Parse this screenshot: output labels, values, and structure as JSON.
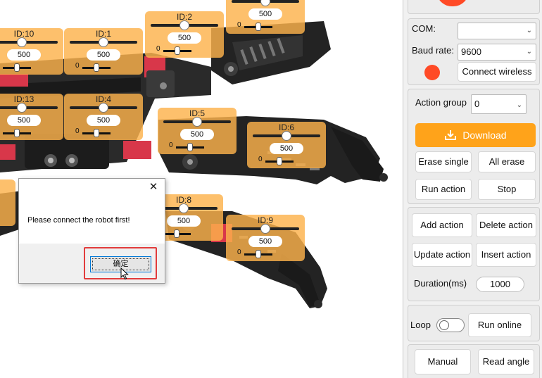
{
  "servos": [
    {
      "id": "ID:10",
      "value": "500",
      "zero": "0"
    },
    {
      "id": "ID:1",
      "value": "500",
      "zero": "0"
    },
    {
      "id": "ID:2",
      "value": "500",
      "zero": "0"
    },
    {
      "id": "",
      "value": "500",
      "zero": "0"
    },
    {
      "id": "ID:13",
      "value": "500",
      "zero": "0"
    },
    {
      "id": "ID:4",
      "value": "500",
      "zero": "0"
    },
    {
      "id": "ID:5",
      "value": "500",
      "zero": "0"
    },
    {
      "id": "ID:6",
      "value": "500",
      "zero": "0"
    },
    {
      "id": "ID:8",
      "value": "500",
      "zero": "0"
    },
    {
      "id": "ID:9",
      "value": "500",
      "zero": "0"
    }
  ],
  "dialog": {
    "message": "Please connect the robot first!",
    "ok_label": "确定",
    "close_glyph": "✕"
  },
  "connection": {
    "com_label": "COM:",
    "com_value": "",
    "baud_label": "Baud rate:",
    "baud_value": "9600",
    "connect_label": "Connect wireless",
    "status_color": "#ff4a26"
  },
  "action": {
    "group_label": "Action group",
    "group_value": "0",
    "download_label": "Download",
    "erase_single": "Erase single",
    "all_erase": "All erase",
    "run_action": "Run action",
    "stop": "Stop"
  },
  "editing": {
    "add_action": "Add action",
    "delete_action": "Delete action",
    "update_action": "Update action",
    "insert_action": "Insert action",
    "duration_label": "Duration(ms)",
    "duration_value": "1000"
  },
  "online": {
    "loop_label": "Loop",
    "loop_on": false,
    "run_online": "Run online"
  },
  "bottom": {
    "manual": "Manual",
    "read_angle": "Read angle"
  },
  "colors": {
    "accent": "#ffa31a",
    "servo_panel": "#fdb24c",
    "highlight": "#e23b3b"
  }
}
